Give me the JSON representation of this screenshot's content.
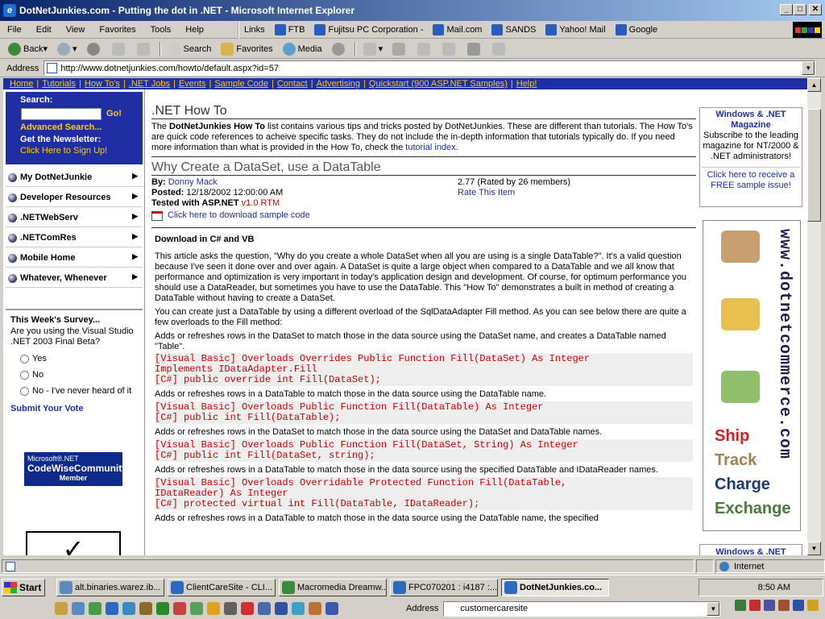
{
  "window": {
    "title": "DotNetJunkies.com - Putting the dot in .NET - Microsoft Internet Explorer",
    "minimize": "_",
    "maximize": "□",
    "close": "✕"
  },
  "menubar": [
    "File",
    "Edit",
    "View",
    "Favorites",
    "Tools",
    "Help"
  ],
  "links": {
    "label": "Links",
    "items": [
      "FTB",
      "Fujitsu PC Corporation -",
      "Mail.com",
      "SANDS",
      "Yahoo! Mail",
      "Google"
    ]
  },
  "toolbar": {
    "back": "Back",
    "search": "Search",
    "favorites": "Favorites",
    "media": "Media"
  },
  "address": {
    "label": "Address",
    "url": "http://www.dotnetjunkies.com/howto/default.aspx?id=57"
  },
  "topnav": [
    "Home",
    "Tutorials",
    "How To's",
    ".NET Jobs",
    "Events",
    "Sample Code",
    "Contact",
    "Advertising",
    "Quickstart (900 ASP.NET Samples)",
    "Help!"
  ],
  "left": {
    "search_label": "Search:",
    "go": "Go!",
    "advanced": "Advanced Search...",
    "newsletter": "Get the Newsletter:",
    "signup": "Click Here to Sign Up!",
    "menu": [
      "My DotNetJunkie",
      "Developer Resources",
      ".NETWebServ",
      ".NETComRes",
      "Mobile Home",
      "Whatever, Whenever"
    ],
    "survey": {
      "title": "This Week's Survey...",
      "question": "Are you using the Visual Studio .NET 2003 Final Beta?",
      "options": [
        "Yes",
        "No",
        "No - I've never heard of it"
      ],
      "submit": "Submit Your Vote"
    },
    "codewise": {
      "line1": "Microsoft®.NET",
      "line2": "CodeWiseCommunity",
      "line3": "Member"
    }
  },
  "main": {
    "heading": ".NET How To",
    "intro_brand": "DotNetJunkies How To",
    "intro_a": "The ",
    "intro_b": " list contains various tips and tricks posted by DotNetJunkies. These are different than tutorials. The How To's are quick code references to acheive specific tasks. They do not include the in-depth information that tutorials typically do. If you need more information than what is provided in the How To, check the ",
    "intro_link": "tutorial index",
    "intro_end": ".",
    "article_title": "Why Create a DataSet, use a DataTable",
    "by_label": "By:",
    "author": "Donny Mack",
    "posted_label": "Posted:",
    "posted": "12/18/2002 12:00:00 AM",
    "tested_label": "Tested with ASP.NET",
    "tested_version": "v1.0 RTM",
    "rating": "2.77 (Rated by 26 members)",
    "rate_link": "Rate This Item",
    "download_link": "Click here to download sample code",
    "download_heading": "Download in C# and VB",
    "p1": "This article asks the question, \"Why do you create a whole DataSet when all you are using is a single DataTable?\". It's a valid question because I've seen it done over and over again. A DataSet is quite a large object when compared to a DataTable and we all know that performance and optimization is very important in today's application design and development. Of course, for optimum performance you should use a DataReader, but sometimes you have to use the DataTable. This \"How To\" demonstrates a built in method of creating a DataTable without having to create a DataSet.",
    "p2": "You can create just a DataTable by using a different overload of the SqlDataAdapter Fill method. As you can see below there are quite a few overloads to the Fill method:",
    "desc1": "Adds or refreshes rows in the DataSet to match those in the data source using the DataSet name, and creates a DataTable named \"Table\".",
    "code1a": "[Visual Basic] Overloads Overrides Public Function Fill(DataSet) As Integer",
    "code1b": "Implements IDataAdapter.Fill",
    "code1c": "[C#] public override int Fill(DataSet);",
    "desc2": "Adds or refreshes rows in a DataTable to match those in the data source using the DataTable name.",
    "code2a": "[Visual Basic] Overloads Public Function Fill(DataTable) As Integer",
    "code2b": "[C#] public int Fill(DataTable);",
    "desc3": "Adds or refreshes rows in the DataSet to match those in the data source using the DataSet and DataTable names.",
    "code3a": "[Visual Basic] Overloads Public Function Fill(DataSet, String) As Integer",
    "code3b": "[C#] public int Fill(DataSet, string);",
    "desc4": "Adds or refreshes rows in a DataTable to match those in the data source using the specified DataTable and IDataReader names.",
    "code4a": "[Visual Basic] Overloads Overridable Protected Function Fill(DataTable,",
    "code4b": "IDataReader) As Integer",
    "code4c": "[C#] protected virtual int Fill(DataTable, IDataReader);",
    "desc5": "Adds or refreshes rows in a DataTable to match those in the data source using the DataTable name, the specified"
  },
  "right": {
    "mag_title": "Windows & .NET Magazine",
    "mag_text": "Subscribe to the leading magazine for NT/2000 & .NET administrators!",
    "mag_link": "Click here to receive a FREE sample issue!",
    "ad_url": "www.dotnetcommerce.com",
    "ad_words": [
      "Ship",
      "Track",
      "Charge",
      "Exchange"
    ],
    "mag2_title": "Windows & .NET"
  },
  "status": {
    "text": "",
    "zone": "Internet"
  },
  "taskbar": {
    "start": "Start",
    "tasks": [
      "alt.binaries.warez.ib...",
      "ClientCareSite - CLI...",
      "Macromedia Dreamw...",
      "FPC070201 : i4187 :...",
      "DotNetJunkies.co..."
    ],
    "clock": "8:50 AM",
    "address_label": "Address",
    "address_value": "customercaresite"
  },
  "colors": {
    "nav_bg": "#1f2ea3",
    "nav_text": "#ffcc00",
    "code_red": "#cc0000",
    "ad_ship": "#cc2222",
    "ad_track": "#a08050",
    "ad_charge": "#1a3a7a",
    "ad_exchange": "#4a7a3a"
  }
}
